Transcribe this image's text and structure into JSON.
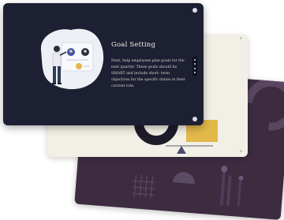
{
  "slides": {
    "front": {
      "title": "Goal Setting",
      "body": "Next, help employees plan goals for the next quarter. These goals should be SMART and include short- term objectives for the specific duties in their current role."
    }
  },
  "colors": {
    "front_bg": "#1d2033",
    "middle_bg": "#f2f0e6",
    "back_bg": "#3d2c40",
    "accent_yellow": "#e2b84a",
    "illustration_blob": "#eef0f6"
  },
  "icons": {
    "pagination": "vertical-dots-icon",
    "corner": "circle-dot-icon"
  }
}
